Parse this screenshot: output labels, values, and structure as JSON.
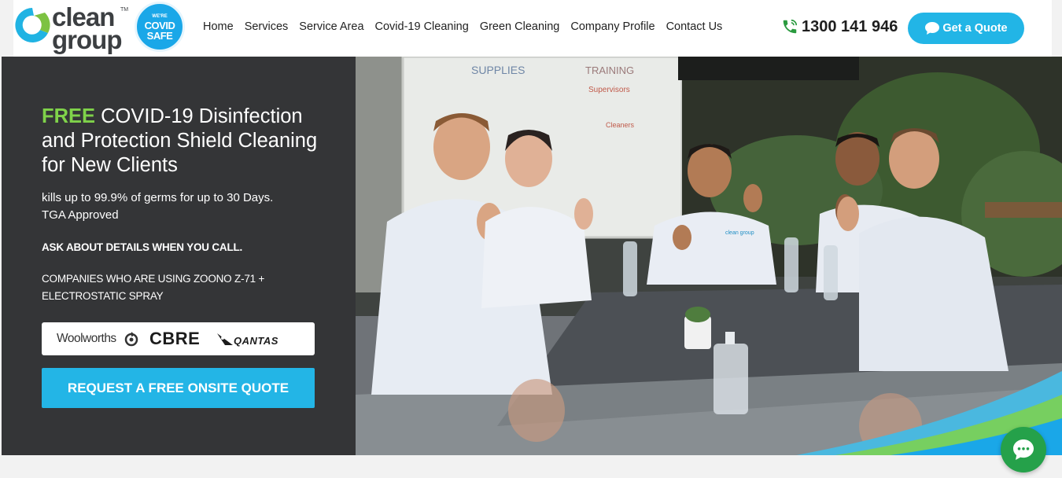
{
  "header": {
    "logo_text_line1": "clean",
    "logo_text_line2": "group",
    "logo_tm": "TM",
    "badge_line1": "WE'RE",
    "badge_line2": "COVID",
    "badge_line3": "SAFE",
    "nav": [
      {
        "label": "Home"
      },
      {
        "label": "Services"
      },
      {
        "label": "Service Area"
      },
      {
        "label": "Covid-19 Cleaning"
      },
      {
        "label": "Green Cleaning"
      },
      {
        "label": "Company Profile"
      },
      {
        "label": "Contact Us"
      }
    ],
    "phone": "1300 141 946",
    "quote_button": "Get a Quote"
  },
  "hero": {
    "headline_free": "FREE",
    "headline_rest": " COVID-19 Disinfection and Protection Shield Cleaning for New Clients",
    "subtitle_line1": "kills up to 99.9% of germs for up to 30 Days.",
    "subtitle_line2": "TGA Approved",
    "ask_details": "ASK ABOUT DETAILS WHEN YOU CALL.",
    "companies_text": "COMPANIES WHO ARE USING ZOONO Z-71 + ELECTROSTATIC SPRAY",
    "client_logos": {
      "woolworths": "Woolworths",
      "cbre": "CBRE",
      "qantas": "QANTAS"
    },
    "cta_button": "REQUEST A FREE ONSITE QUOTE",
    "whiteboard_words": [
      "SUPPLIES",
      "TRAINING",
      "Supervisors",
      "Cleaners"
    ],
    "shirt_logo": "clean group"
  },
  "colors": {
    "accent_blue": "#23b5e6",
    "accent_green": "#7fd24a",
    "dark_panel": "#343537",
    "chat_green": "#25a14a"
  },
  "icons": {
    "phone": "phone-icon",
    "chat": "chat-bubble-icon",
    "fab": "chat-fab-icon"
  }
}
